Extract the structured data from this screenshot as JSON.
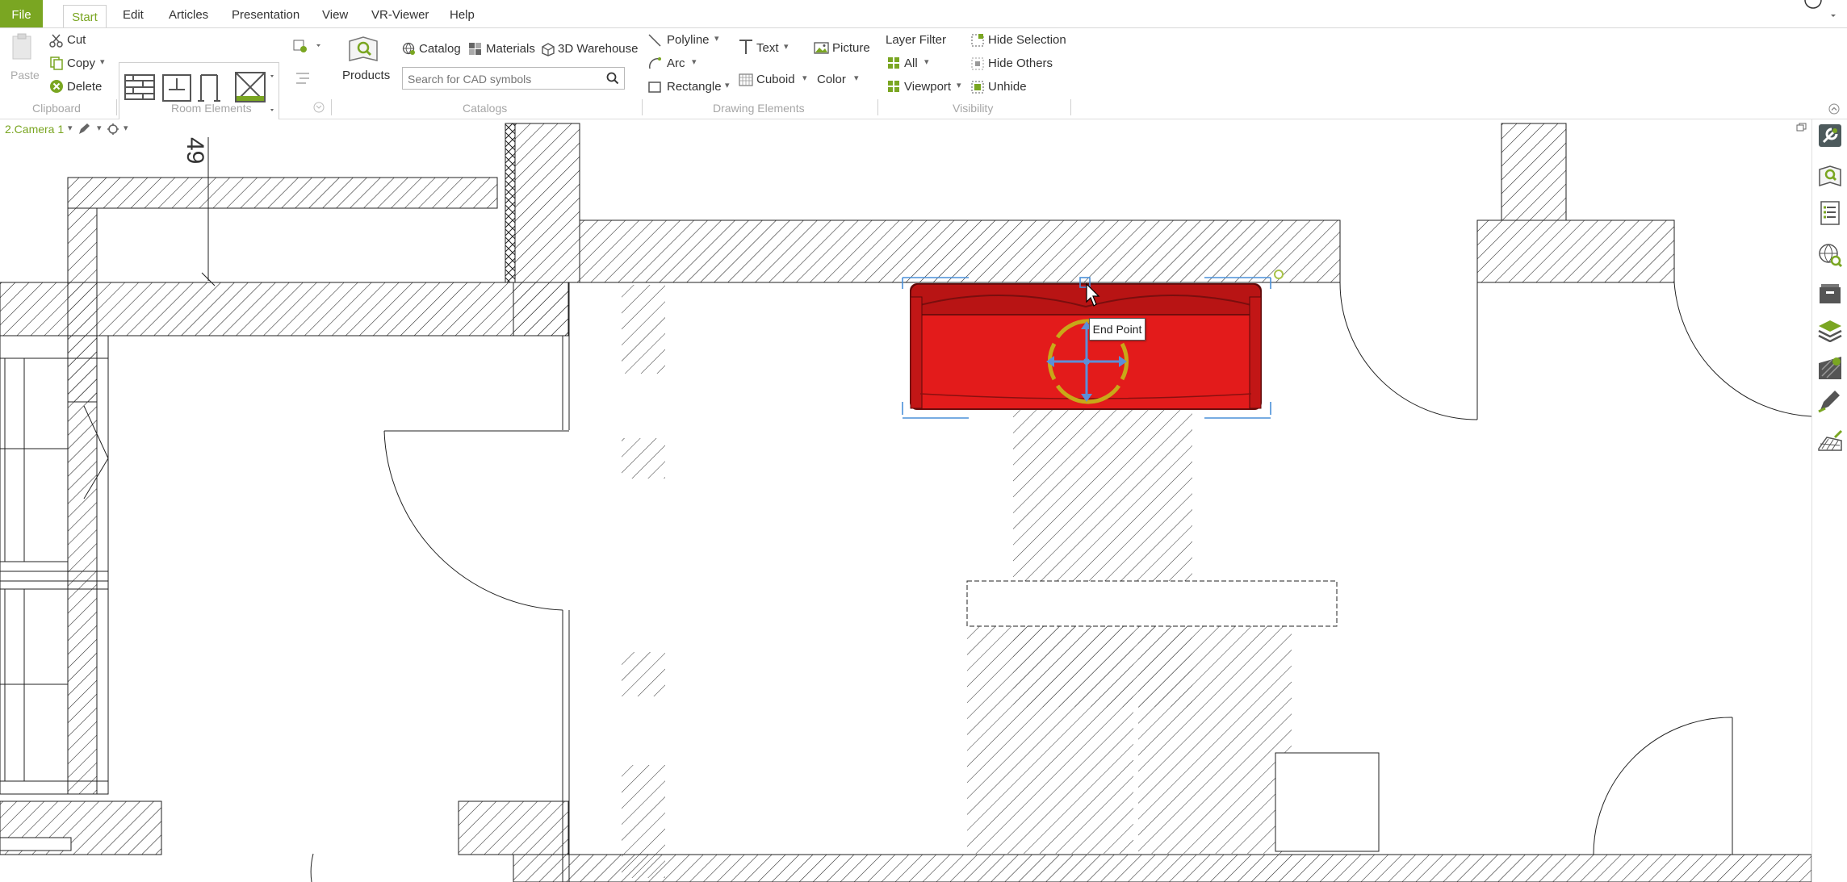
{
  "menu": {
    "file": "File",
    "start": "Start",
    "edit": "Edit",
    "articles": "Articles",
    "presentation": "Presentation",
    "view": "View",
    "vr_viewer": "VR-Viewer",
    "help": "Help"
  },
  "ribbon": {
    "clipboard": {
      "paste": "Paste",
      "cut": "Cut",
      "copy": "Copy",
      "delete": "Delete",
      "group": "Clipboard"
    },
    "room_elements": {
      "group": "Room Elements"
    },
    "catalogs": {
      "products": "Products",
      "catalog": "Catalog",
      "materials": "Materials",
      "warehouse": "3D Warehouse",
      "search_placeholder": "Search for CAD symbols",
      "group": "Catalogs"
    },
    "drawing": {
      "polyline": "Polyline",
      "arc": "Arc",
      "rectangle": "Rectangle",
      "text": "Text",
      "cuboid": "Cuboid",
      "picture": "Picture",
      "color": "Color",
      "group": "Drawing Elements"
    },
    "visibility": {
      "layer_filter": "Layer Filter",
      "all": "All",
      "viewport": "Viewport",
      "hide_selection": "Hide Selection",
      "hide_others": "Hide Others",
      "unhide": "Unhide",
      "group": "Visibility"
    }
  },
  "viewport": {
    "camera_label": "2.Camera 1",
    "dimension_label": "49",
    "tooltip": "End Point"
  },
  "colors": {
    "accent": "#7aa622",
    "sofa": "#e31b1b",
    "selection": "#4a90d9"
  },
  "icons": {
    "right_toolbar": [
      "settings-wrench-icon",
      "catalog-search-icon",
      "list-icon",
      "globe-search-icon",
      "archive-icon",
      "layers-icon",
      "material-icon",
      "pen-icon",
      "terrain-icon"
    ]
  }
}
